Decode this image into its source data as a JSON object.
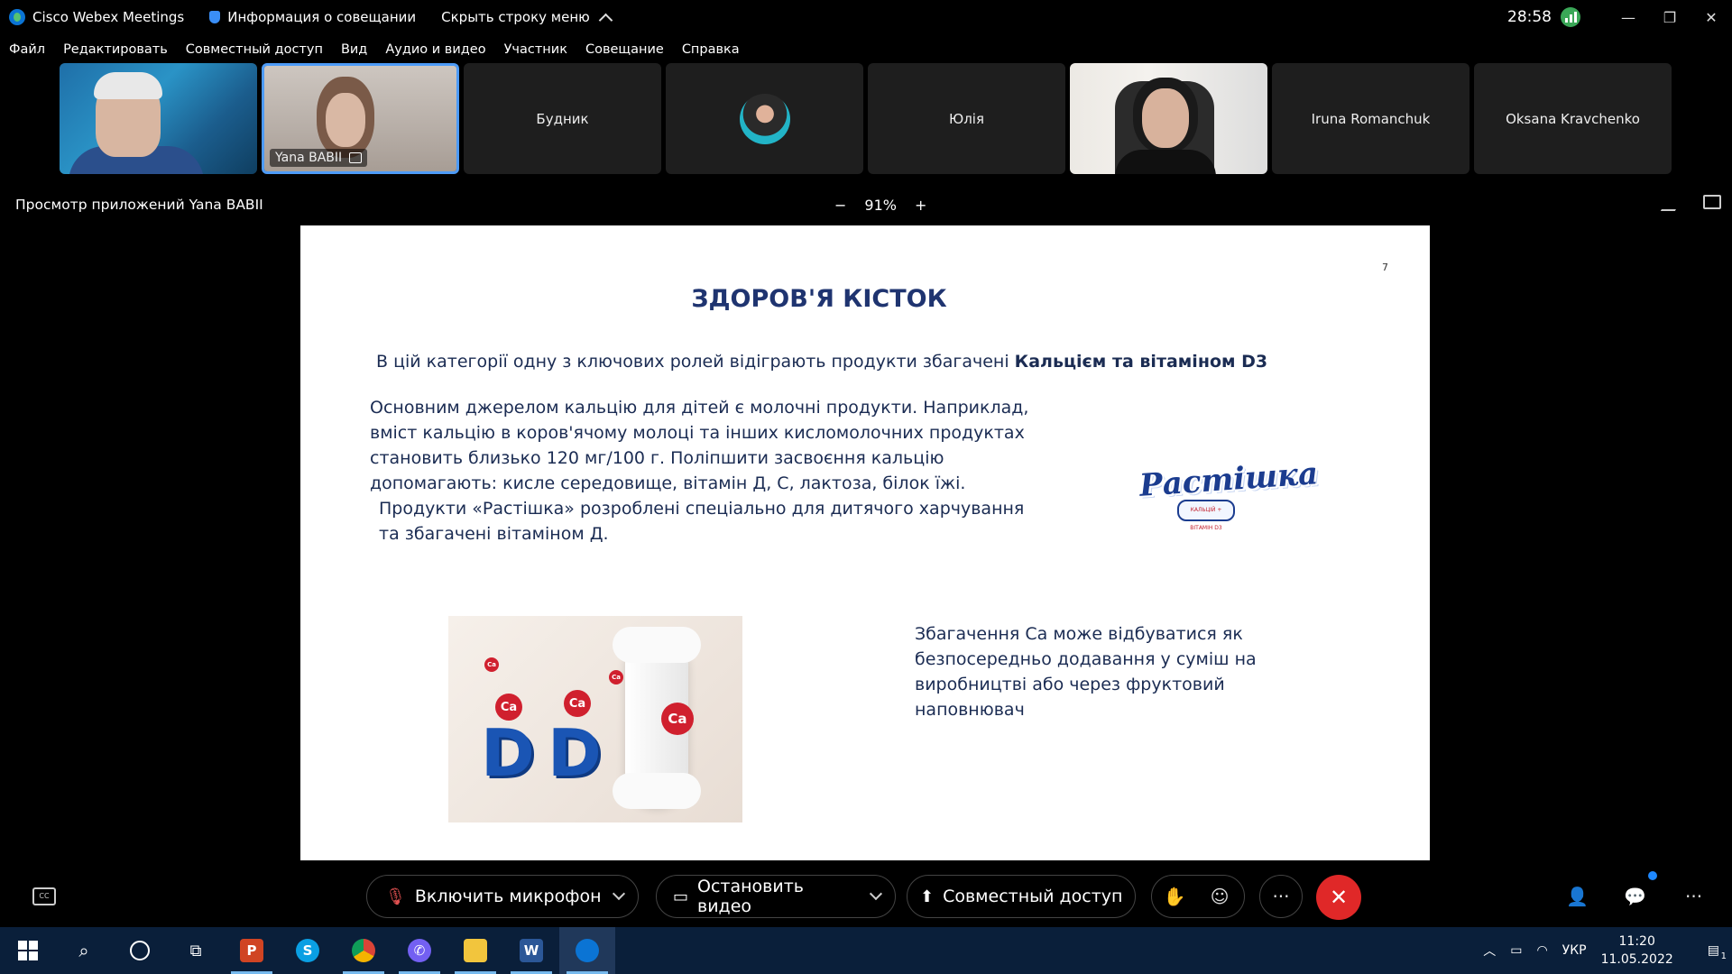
{
  "window": {
    "app_title": "Cisco Webex Meetings",
    "meeting_info": "Информация о совещании",
    "hide_menu": "Скрыть строку меню",
    "timer": "28:58"
  },
  "menu": [
    "Файл",
    "Редактировать",
    "Совместный доступ",
    "Вид",
    "Аудио и видео",
    "Участник",
    "Совещание",
    "Справка"
  ],
  "participants": {
    "p2_name": "Yana BABII",
    "p3_name": "Будник",
    "p5_name": "Юлія",
    "p7_name": "Iruna Romanchuk",
    "p8_name": "Oksana Kravchenko"
  },
  "viewbar": {
    "title": "Просмотр приложений Yana BABII",
    "zoom": "91%",
    "minus": "−",
    "plus": "+"
  },
  "slide": {
    "page_number": "7",
    "title": "ЗДОРОВ'Я КІСТОК",
    "intro": "В цій категорії одну з ключових ролей відіграють продукти збагачені ",
    "intro_bold": "Кальцієм та вітаміном D3",
    "para1": "Основним джерелом кальцію для дітей є молочні продукти. Наприклад, вміст кальцію в коров'ячому молоці та інших кисломолочних продуктах становить близько 120 мг/100 г. Поліпшити засвоєння кальцію допомагають: кисле середовище, вітамін Д, С, лактоза, білок їжі.",
    "para2": "Продукти «Растішка» розроблені спеціально для дитячого харчування та збагачені вітаміном Д.",
    "brand": "Растішка",
    "brand_sub": "КАЛЬЦІЙ + ВІТАМІН D3",
    "ca_label": "Ca",
    "d_label": "D",
    "side_text": "Збагачення Са може відбуватися як безпосередньо додавання у суміш на виробництві або через фруктовий наповнювач"
  },
  "controls": {
    "mic": "Включить микрофон",
    "video": "Остановить видео",
    "share": "Совместный доступ"
  },
  "taskbar": {
    "lang": "УКР",
    "time": "11:20",
    "date": "11.05.2022",
    "notif_count": "1"
  }
}
